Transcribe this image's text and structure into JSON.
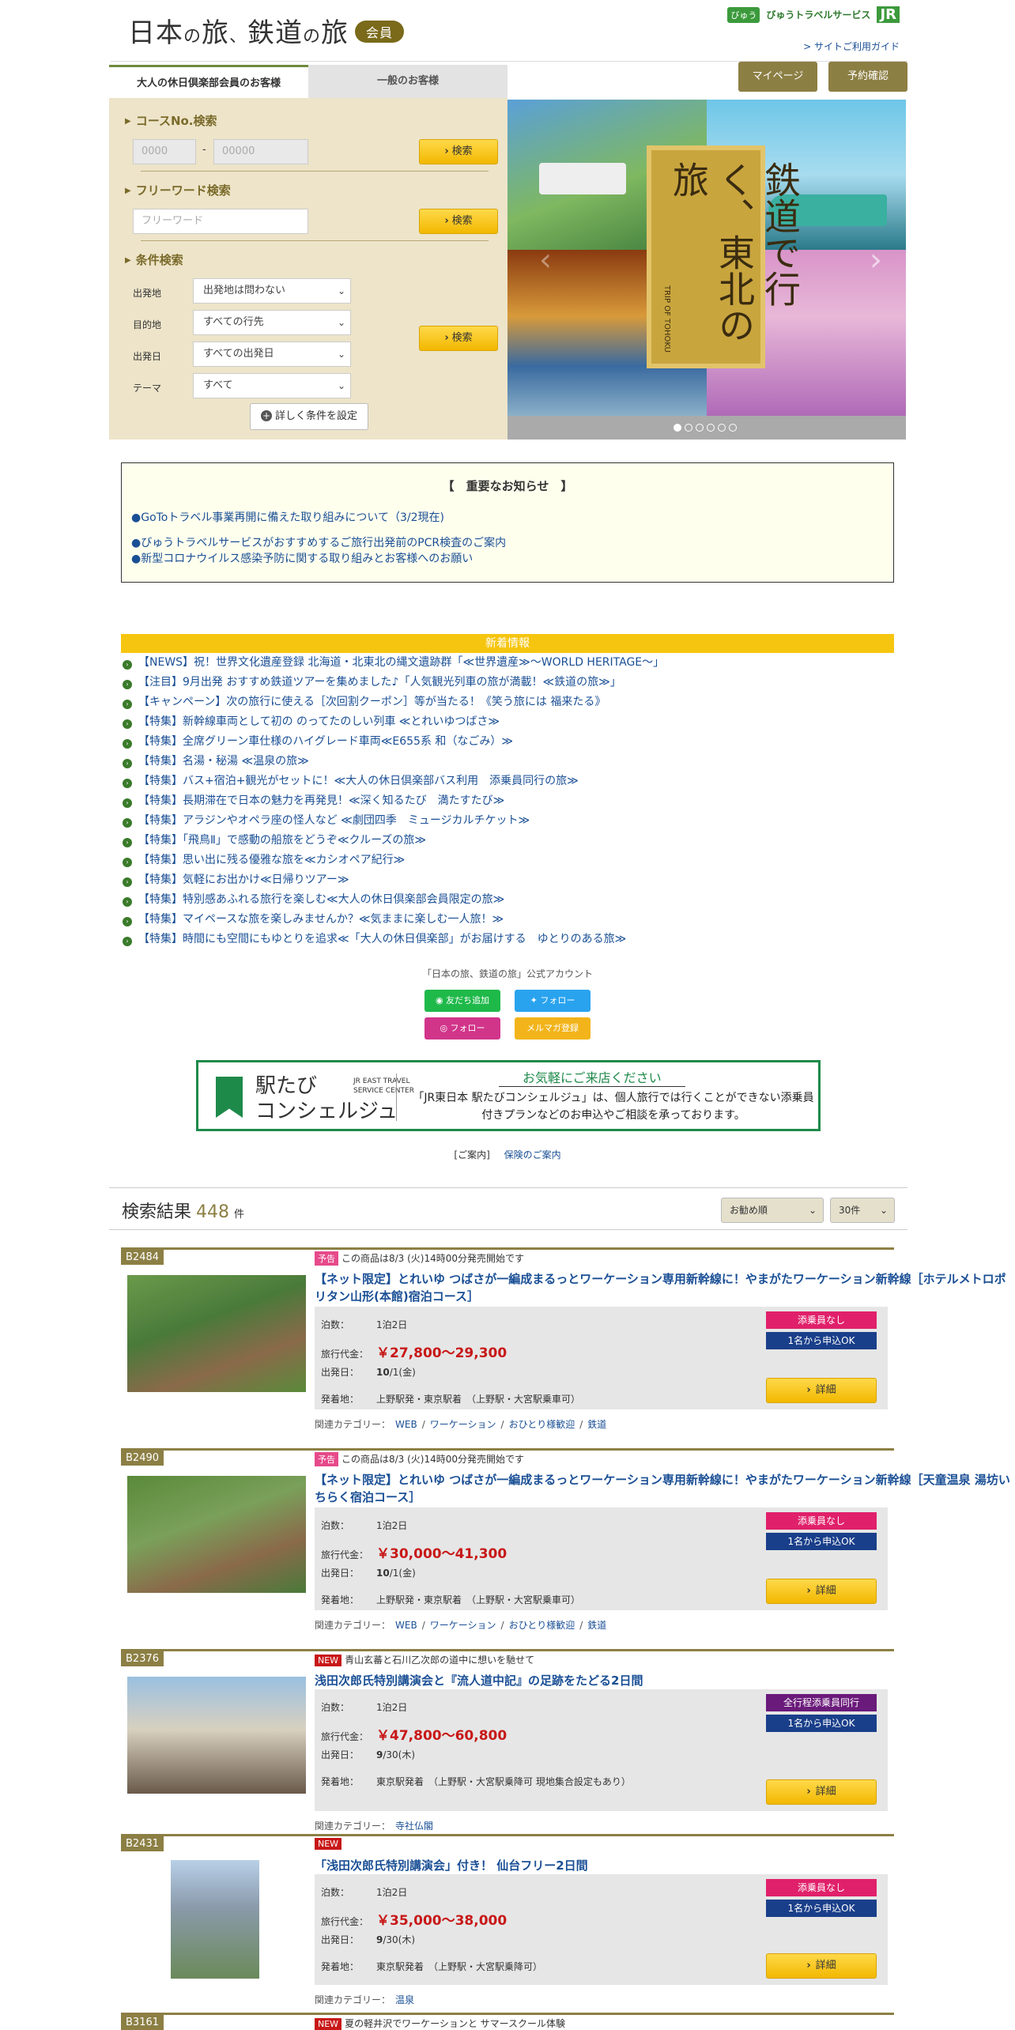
{
  "header": {
    "logo_part1": "日本",
    "logo_no1": "の",
    "logo_part2": "旅",
    "logo_comma": "、",
    "logo_part3": "鉄道",
    "logo_no2": "の",
    "logo_part4": "旅",
    "member_badge": "会員",
    "brand_view": "びゅう",
    "brand_text": "びゅうトラベルサービス",
    "brand_jr": "JR",
    "guide_link": "> サイトご利用ガイド",
    "mypage": "マイページ",
    "reservation": "予約確認"
  },
  "search": {
    "tab_member": "大人の休日倶楽部会員のお客様",
    "tab_general": "一般のお客様",
    "course_title": "コースNo.検索",
    "course_ph1": "0000",
    "course_dash": "-",
    "course_ph2": "00000",
    "search_label": "検索",
    "free_title": "フリーワード検索",
    "free_ph": "フリーワード",
    "cond_title": "条件検索",
    "departure_label": "出発地",
    "departure_value": "出発地は問わない",
    "dest_label": "目的地",
    "dest_value": "すべての行先",
    "date_label": "出発日",
    "date_value": "すべての出発日",
    "theme_label": "テーマ",
    "theme_value": "すべて",
    "detail_btn": "詳しく条件を設定"
  },
  "banner": {
    "sign_text": "鉄道で行く、東北の旅",
    "sign_sub": "TRIP OF TOHOKU",
    "active_slide": 1,
    "slide_count": 6
  },
  "notice": {
    "title": "【　重要なお知らせ　】",
    "links": [
      "●GoToトラベル事業再開に備えた取り組みについて（3/2現在)",
      "●びゅうトラベルサービスがおすすめするご旅行出発前のPCR検査のご案内",
      "●新型コロナウイルス感染予防に関する取り組みとお客様へのお願い"
    ]
  },
  "news": {
    "title": "新着情報",
    "items": [
      "【NEWS】祝！世界文化遺産登録 北海道・北東北の縄文遺跡群「≪世界遺産≫～WORLD HERITAGE～」",
      "【注目】9月出発 おすすめ鉄道ツアーを集めました♪「人気観光列車の旅が満載！≪鉄道の旅≫」",
      "【キャンペーン】次の旅行に使える［次回割クーポン］等が当たる！《笑う旅には 福来たる》",
      "【特集】新幹線車両として初の のってたのしい列車 ≪とれいゆつばさ≫",
      "【特集】全席グリーン車仕様のハイグレード車両≪E655系 和（なごみ）≫",
      "【特集】名湯・秘湯 ≪温泉の旅≫",
      "【特集】バス+宿泊+観光がセットに！≪大人の休日倶楽部バス利用　添乗員同行の旅≫",
      "【特集】長期滞在で日本の魅力を再発見！≪深く知るたび　満たすたび≫",
      "【特集】アラジンやオペラ座の怪人など ≪劇団四季　ミュージカルチケット≫",
      "【特集】「飛鳥Ⅱ」で感動の船旅をどうぞ≪クルーズの旅≫",
      "【特集】思い出に残る優雅な旅を≪カシオペア紀行≫",
      "【特集】気軽にお出かけ≪日帰りツアー≫",
      "【特集】特別感あふれる旅行を楽しむ≪大人の休日倶楽部会員限定の旅≫",
      "【特集】マイペースな旅を楽しみませんか？≪気ままに楽しむ一人旅！≫",
      "【特集】時間にも空間にもゆとりを追求≪「大人の休日倶楽部」がお届けする　ゆとりのある旅≫"
    ]
  },
  "sns": {
    "title": "「日本の旅、鉄道の旅」公式アカウント",
    "line": "友だち追加",
    "twitter": "フォロー",
    "instagram": "フォロー",
    "mail": "メルマガ登録"
  },
  "ekitabi": {
    "name1": "駅たび",
    "name2": "コンシェルジュ",
    "sub1": "JR EAST TRAVEL",
    "sub2": "SERVICE CENTER",
    "head": "お気軽にご来店ください",
    "body": "「JR東日本 駅たびコンシェルジュ」は、個人旅行では行くことができない添乗員付きプランなどのお申込やご相談を承っております。"
  },
  "links": {
    "guide": "[ご案内]",
    "insurance": "保険のご案内"
  },
  "results": {
    "label": "検索結果",
    "count": "448",
    "unit": "件",
    "sort": "お勧め順",
    "per_page": "30件"
  },
  "labels": {
    "nights": "泊数：",
    "price": "旅行代金：",
    "date": "出発日：",
    "depart": "発着地：",
    "detail": "詳細",
    "related": "関連カテゴリー："
  },
  "items": [
    {
      "code": "B2484",
      "tag": "予告",
      "tagline": "この商品は8/3 (火)14時00分発売開始です",
      "title": "【ネット限定】とれいゆ つばさが一編成まるっとワーケーション専用新幹線に！やまがたワーケーション新幹線［ホテルメトロポリタン山形(本館)宿泊コース］",
      "nights": "1泊2日",
      "price": "￥27,800～29,300",
      "date_b": "10",
      "date_rest": "/1(金)",
      "depart": "上野駅発・東京駅着　（上野駅・大宮駅乗車可）",
      "badge1": "添乗員なし",
      "badge2": "1名から申込OK",
      "cats": [
        "WEB",
        "ワーケーション",
        "おひとり様歓迎",
        "鉄道"
      ]
    },
    {
      "code": "B2490",
      "tag": "予告",
      "tagline": "この商品は8/3 (火)14時00分発売開始です",
      "title": "【ネット限定】とれいゆ つばさが一編成まるっとワーケーション専用新幹線に！やまがたワーケーション新幹線［天童温泉 湯坊いちらく宿泊コース］",
      "nights": "1泊2日",
      "price": "￥30,000～41,300",
      "date_b": "10",
      "date_rest": "/1(金)",
      "depart": "上野駅発・東京駅着　（上野駅・大宮駅乗車可）",
      "badge1": "添乗員なし",
      "badge2": "1名から申込OK",
      "cats": [
        "WEB",
        "ワーケーション",
        "おひとり様歓迎",
        "鉄道"
      ]
    },
    {
      "code": "B2376",
      "tag": "NEW",
      "tagline": "青山玄蕃と石川乙次郎の道中に想いを馳せて",
      "title": "浅田次郎氏特別講演会と『流人道中記』の足跡をたどる2日間",
      "nights": "1泊2日",
      "price": "￥47,800～60,800",
      "date_b": "9",
      "date_rest": "/30(木)",
      "depart": "東京駅発着　（上野駅・大宮駅乗降可 現地集合設定もあり）",
      "badge1": "全行程添乗員同行",
      "badge2": "1名から申込OK",
      "cats": [
        "寺社仏閣"
      ]
    },
    {
      "code": "B2431",
      "tag": "NEW",
      "tagline": "",
      "title": "「浅田次郎氏特別講演会」付き！ 仙台フリー2日間",
      "nights": "1泊2日",
      "price": "￥35,000～38,000",
      "date_b": "9",
      "date_rest": "/30(木)",
      "depart": "東京駅発着　（上野駅・大宮駅乗降可）",
      "badge1": "添乗員なし",
      "badge2": "1名から申込OK",
      "cats": [
        "温泉"
      ]
    },
    {
      "code": "B3161",
      "tag": "NEW",
      "tagline": "夏の軽井沢でワーケーションと サマースクール体験"
    }
  ]
}
